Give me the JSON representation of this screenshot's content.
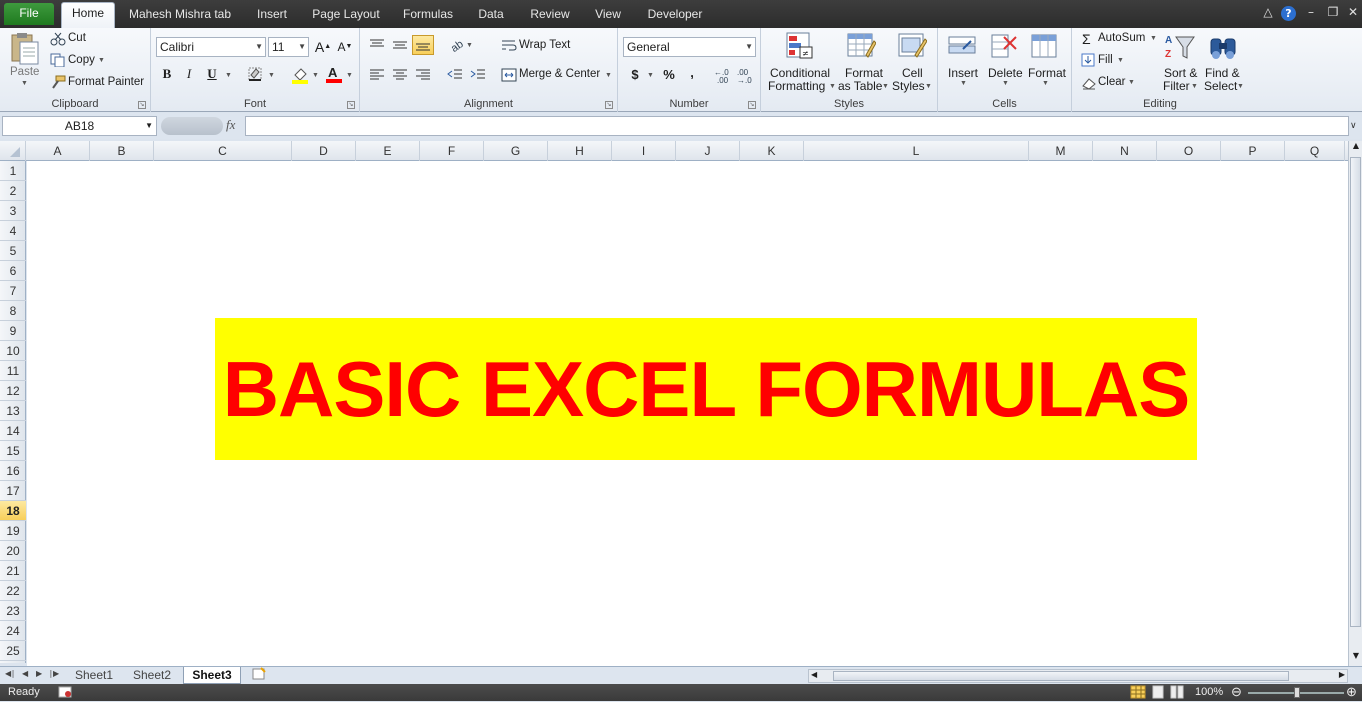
{
  "tabs": {
    "file": "File",
    "home": "Home",
    "custom": "Mahesh Mishra tab",
    "insert": "Insert",
    "page_layout": "Page Layout",
    "formulas": "Formulas",
    "data": "Data",
    "review": "Review",
    "view": "View",
    "developer": "Developer"
  },
  "clipboard": {
    "title": "Clipboard",
    "paste": "Paste",
    "cut": "Cut",
    "copy": "Copy",
    "format_painter": "Format Painter"
  },
  "font": {
    "title": "Font",
    "family": "Calibri",
    "size": "11",
    "bold": "B",
    "italic": "I",
    "underline": "U"
  },
  "alignment": {
    "title": "Alignment",
    "wrap_text": "Wrap Text",
    "merge_center": "Merge & Center"
  },
  "number": {
    "title": "Number",
    "format": "General",
    "currency": "$",
    "percent": "%",
    "comma": ","
  },
  "styles": {
    "title": "Styles",
    "conditional_1": "Conditional",
    "conditional_2": "Formatting",
    "format_table_1": "Format",
    "format_table_2": "as Table",
    "cell_styles_1": "Cell",
    "cell_styles_2": "Styles"
  },
  "cells": {
    "title": "Cells",
    "insert": "Insert",
    "delete": "Delete",
    "format": "Format"
  },
  "editing": {
    "title": "Editing",
    "autosum": "AutoSum",
    "fill": "Fill",
    "clear": "Clear",
    "sort_1": "Sort &",
    "sort_2": "Filter",
    "find_1": "Find &",
    "find_2": "Select"
  },
  "formula_bar": {
    "name_box": "AB18",
    "fx": "fx",
    "value": ""
  },
  "grid": {
    "columns": [
      "A",
      "B",
      "C",
      "D",
      "E",
      "F",
      "G",
      "H",
      "I",
      "J",
      "K",
      "L",
      "M",
      "N",
      "O",
      "P",
      "Q"
    ],
    "rows": [
      "1",
      "2",
      "3",
      "4",
      "5",
      "6",
      "7",
      "8",
      "9",
      "10",
      "11",
      "12",
      "13",
      "14",
      "15",
      "16",
      "17",
      "18",
      "19",
      "20",
      "21",
      "22",
      "23",
      "24",
      "25"
    ],
    "selected_row": "18",
    "banner_text": "BASIC EXCEL FORMULAS",
    "banner_fill": "#ffff00",
    "banner_color": "#ff0000"
  },
  "sheets": [
    "Sheet1",
    "Sheet2",
    "Sheet3"
  ],
  "active_sheet": "Sheet3",
  "status": {
    "ready": "Ready",
    "zoom": "100%"
  },
  "colors": {
    "file_tab": "#2a862a",
    "selection": "#f8cf5a"
  }
}
